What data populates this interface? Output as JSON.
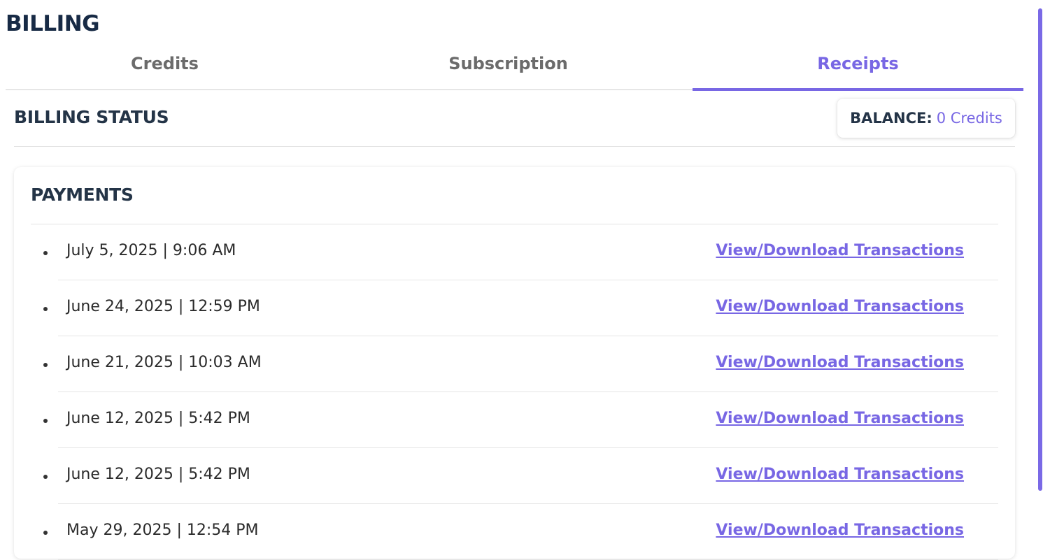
{
  "page": {
    "title": "BILLING"
  },
  "tabs": [
    {
      "label": "Credits",
      "active": false
    },
    {
      "label": "Subscription",
      "active": false
    },
    {
      "label": "Receipts",
      "active": true
    }
  ],
  "billing_status": {
    "title": "BILLING STATUS",
    "balance_label": "BALANCE:",
    "balance_value": "0 Credits"
  },
  "payments": {
    "title": "PAYMENTS",
    "items": [
      {
        "date": "July 5, 2025 | 9:06 AM",
        "link": "View/Download Transactions"
      },
      {
        "date": "June 24, 2025 | 12:59 PM",
        "link": "View/Download Transactions"
      },
      {
        "date": "June 21, 2025 | 10:03 AM",
        "link": "View/Download Transactions"
      },
      {
        "date": "June 12, 2025 | 5:42 PM",
        "link": "View/Download Transactions"
      },
      {
        "date": "June 12, 2025 | 5:42 PM",
        "link": "View/Download Transactions"
      },
      {
        "date": "May 29, 2025 | 12:54 PM",
        "link": "View/Download Transactions"
      }
    ]
  },
  "colors": {
    "accent": "#7867e4",
    "heading": "#172a45",
    "tab_inactive": "#6b6b6b"
  }
}
